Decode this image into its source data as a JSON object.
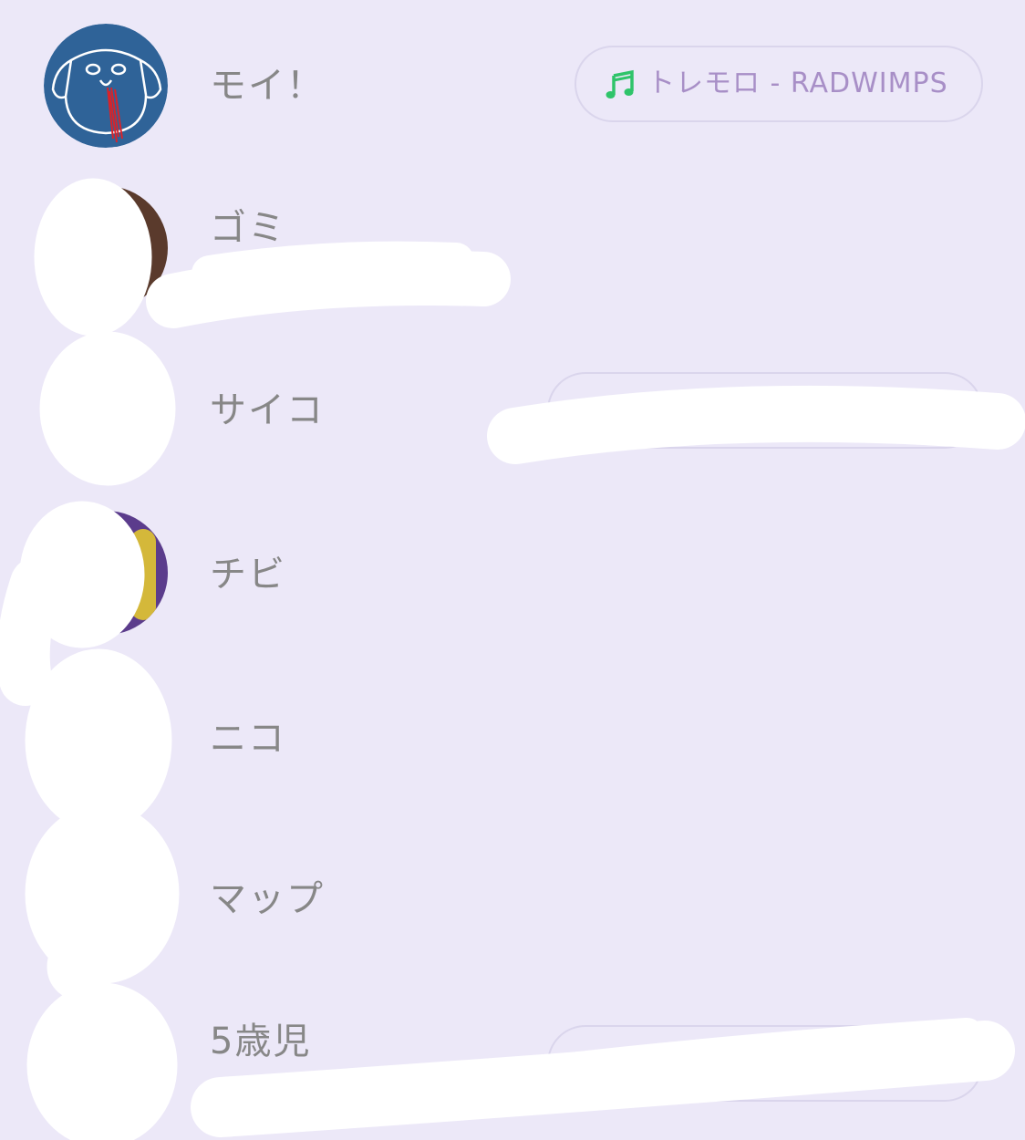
{
  "friends": [
    {
      "name": "モイ！",
      "music": {
        "icon": "music-note-icon",
        "text": "トレモロ - RADWIMPS"
      }
    },
    {
      "name": "ゴミ"
    },
    {
      "name": "サイコ"
    },
    {
      "name": "チビ"
    },
    {
      "name": "ニコ"
    },
    {
      "name": "マップ"
    },
    {
      "name": "5歳児"
    }
  ],
  "colors": {
    "background": "#ECE8F8",
    "name_text": "#878787",
    "music_text": "#A88FC7",
    "music_icon": "#2FC46A",
    "avatar_blue": "#2F6398"
  }
}
